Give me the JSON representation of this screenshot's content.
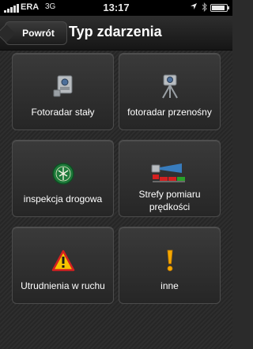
{
  "status_bar": {
    "carrier": "ERA",
    "network": "3G",
    "time": "13:17",
    "location_icon": "location-arrow-icon",
    "bluetooth_icon": "bluetooth-icon",
    "battery_level": 0.9
  },
  "nav": {
    "back_label": "Powrót",
    "title": "Typ zdarzenia"
  },
  "tiles": [
    {
      "label": "Fotoradar stały",
      "icon": "fixed-speed-camera-icon"
    },
    {
      "label": "fotoradar przenośny",
      "icon": "mobile-speed-camera-icon"
    },
    {
      "label": "inspekcja drogowa",
      "icon": "road-inspection-badge-icon"
    },
    {
      "label": "Strefy pomiaru prędkości",
      "icon": "speed-zone-icon"
    },
    {
      "label": "Utrudnienia w ruchu",
      "icon": "warning-triangle-icon"
    },
    {
      "label": "inne",
      "icon": "exclamation-icon"
    }
  ],
  "colors": {
    "warning_yellow": "#f5c400",
    "badge_green": "#1d7a3a",
    "zone_red": "#d42020",
    "zone_blue": "#3a8ee0"
  }
}
